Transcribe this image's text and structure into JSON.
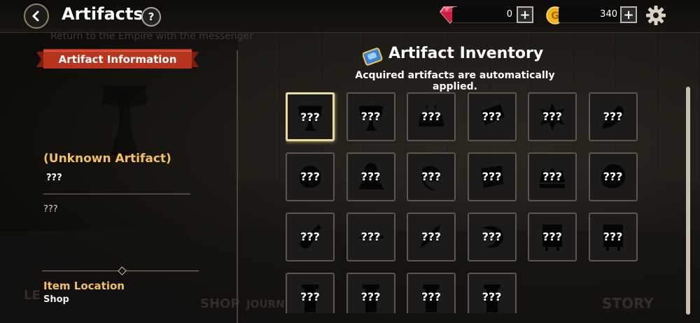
{
  "header": {
    "title": "Artifacts",
    "help_label": "?",
    "gems": "0",
    "gold": "340",
    "plus_label": "+"
  },
  "background": {
    "quest_hint": "Return to the Empire with the messenger",
    "labels": [
      "LE",
      "SHOP",
      "JOURN",
      "STORY"
    ]
  },
  "info_panel": {
    "ribbon_title": "Artifact Information",
    "artifact_name": "(Unknown Artifact)",
    "artifact_subtitle": "???",
    "artifact_description": "???",
    "location_label": "Item Location",
    "location_value": "Shop"
  },
  "inventory": {
    "title": "Artifact Inventory",
    "subtitle": "Acquired artifacts are automatically applied.",
    "selected_index": 0,
    "slots": [
      {
        "label": "???",
        "icon": "eagle-silhouette-icon"
      },
      {
        "label": "???",
        "icon": "eagle-silhouette-icon"
      },
      {
        "label": "???",
        "icon": "cake-silhouette-icon"
      },
      {
        "label": "???",
        "icon": "ticket-silhouette-icon"
      },
      {
        "label": "???",
        "icon": "flower-silhouette-icon"
      },
      {
        "label": "???",
        "icon": "pepper-silhouette-icon"
      },
      {
        "label": "???",
        "icon": "egg-silhouette-icon"
      },
      {
        "label": "???",
        "icon": "bell-silhouette-icon"
      },
      {
        "label": "???",
        "icon": "swirl-silhouette-icon"
      },
      {
        "label": "???",
        "icon": "scroll-silhouette-icon"
      },
      {
        "label": "???",
        "icon": "crown-silhouette-icon"
      },
      {
        "label": "???",
        "icon": "ring-silhouette-icon"
      },
      {
        "label": "???",
        "icon": "vial-silhouette-icon"
      },
      {
        "label": "???",
        "icon": "line-silhouette-icon"
      },
      {
        "label": "???",
        "icon": "feather-silhouette-icon"
      },
      {
        "label": "???",
        "icon": "horn-silhouette-icon"
      },
      {
        "label": "???",
        "icon": "cabinet-silhouette-icon"
      },
      {
        "label": "???",
        "icon": "cabinet-silhouette-icon"
      },
      {
        "label": "???",
        "icon": "pillar-silhouette-icon"
      },
      {
        "label": "???",
        "icon": "pillar-silhouette-icon"
      },
      {
        "label": "???",
        "icon": "pillar-silhouette-icon"
      },
      {
        "label": "???",
        "icon": "pillar-silhouette-icon"
      }
    ]
  },
  "colors": {
    "gold_text": "#f1c160",
    "ribbon_red": "#b7341f",
    "selected_border": "#e8dba0"
  }
}
